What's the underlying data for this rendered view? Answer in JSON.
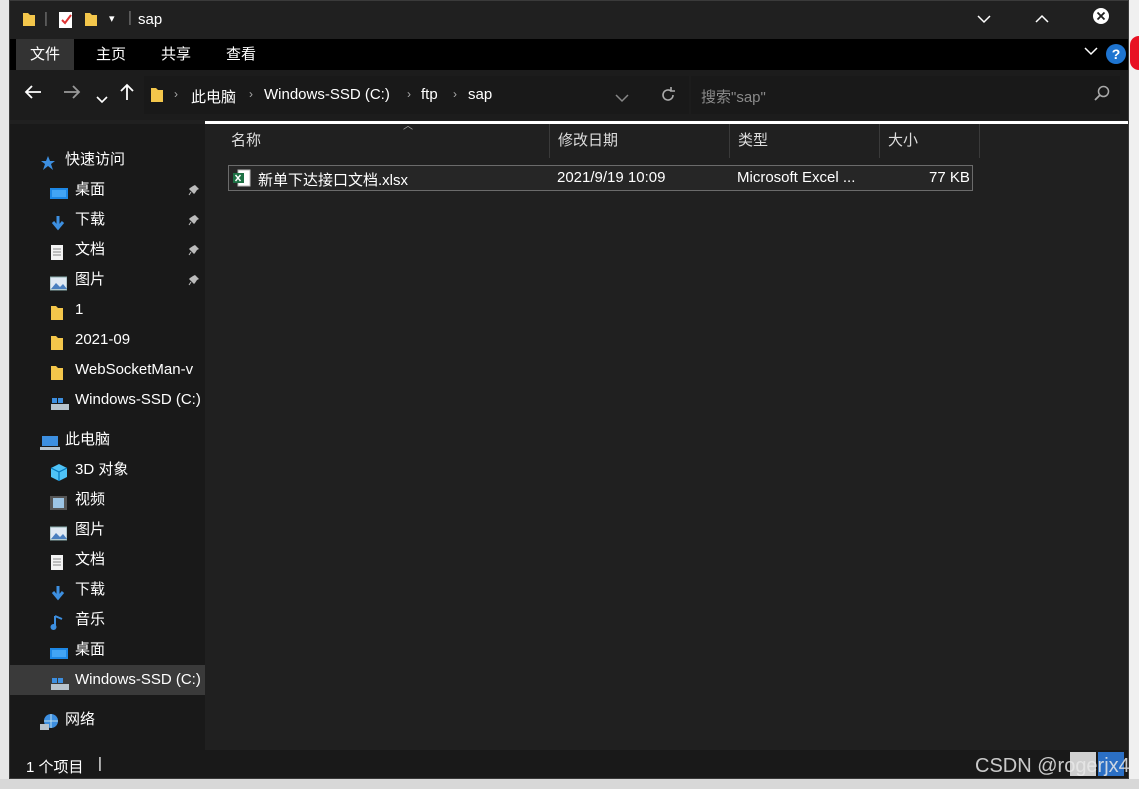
{
  "titlebar": {
    "title": "sap",
    "minimize": "⌵",
    "maximize": "⌃",
    "close": "✕"
  },
  "ribbon": {
    "tabs": [
      {
        "label": "文件",
        "active": true
      },
      {
        "label": "主页",
        "active": false
      },
      {
        "label": "共享",
        "active": false
      },
      {
        "label": "查看",
        "active": false
      }
    ],
    "help": "?"
  },
  "address": {
    "crumbs": [
      "此电脑",
      "Windows-SSD (C:)",
      "ftp",
      "sap"
    ],
    "search_placeholder": "搜索\"sap\""
  },
  "sidebar": {
    "items": [
      {
        "label": "快速访问",
        "icon": "star-icon",
        "pinned": false,
        "indent": 1
      },
      {
        "label": "桌面",
        "icon": "desktop-icon",
        "pinned": true,
        "indent": 2
      },
      {
        "label": "下载",
        "icon": "download-icon",
        "pinned": true,
        "indent": 2
      },
      {
        "label": "文档",
        "icon": "document-icon",
        "pinned": true,
        "indent": 2
      },
      {
        "label": "图片",
        "icon": "picture-icon",
        "pinned": true,
        "indent": 2
      },
      {
        "label": "1",
        "icon": "folder-icon",
        "pinned": false,
        "indent": 2
      },
      {
        "label": "2021-09",
        "icon": "folder-icon",
        "pinned": false,
        "indent": 2
      },
      {
        "label": "WebSocketMan-v",
        "icon": "folder-icon",
        "pinned": false,
        "indent": 2
      },
      {
        "label": "Windows-SSD (C:)",
        "icon": "drive-icon",
        "pinned": false,
        "indent": 2
      },
      {
        "label": "此电脑",
        "icon": "computer-icon",
        "pinned": false,
        "indent": 1
      },
      {
        "label": "3D 对象",
        "icon": "cube-icon",
        "pinned": false,
        "indent": 2
      },
      {
        "label": "视频",
        "icon": "video-icon",
        "pinned": false,
        "indent": 2
      },
      {
        "label": "图片",
        "icon": "picture-icon",
        "pinned": false,
        "indent": 2
      },
      {
        "label": "文档",
        "icon": "document-icon",
        "pinned": false,
        "indent": 2
      },
      {
        "label": "下载",
        "icon": "download-icon",
        "pinned": false,
        "indent": 2
      },
      {
        "label": "音乐",
        "icon": "music-icon",
        "pinned": false,
        "indent": 2
      },
      {
        "label": "桌面",
        "icon": "desktop-icon",
        "pinned": false,
        "indent": 2
      },
      {
        "label": "Windows-SSD (C:)",
        "icon": "drive-icon",
        "pinned": false,
        "indent": 2,
        "selected": true
      },
      {
        "label": "网络",
        "icon": "network-icon",
        "pinned": false,
        "indent": 1
      }
    ]
  },
  "filelist": {
    "columns": [
      "名称",
      "修改日期",
      "类型",
      "大小"
    ],
    "rows": [
      {
        "name": "新单下达接口文档.xlsx",
        "modified": "2021/9/19 10:09",
        "type": "Microsoft Excel ...",
        "size": "77 KB",
        "icon": "excel-icon"
      }
    ]
  },
  "status": {
    "count": "1 个项目",
    "caret": "|"
  },
  "watermark": "CSDN @rogerjx4",
  "colors": {
    "window_bg": "#202020",
    "sidebar_bg": "#191919",
    "accent": "#1e74d0",
    "folder": "#f3c64b"
  }
}
